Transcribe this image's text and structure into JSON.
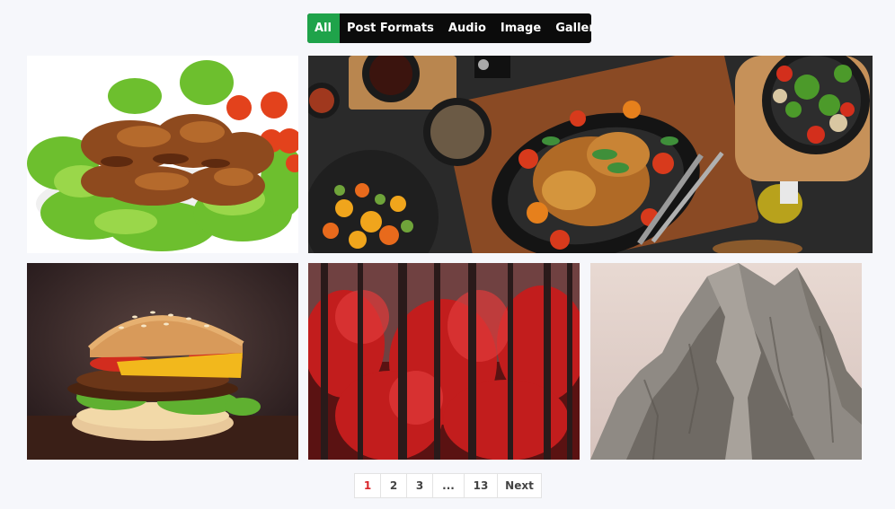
{
  "filters": {
    "items": [
      {
        "label": "All",
        "active": true
      },
      {
        "label": "Post Formats",
        "active": false
      },
      {
        "label": "Audio",
        "active": false
      },
      {
        "label": "Image",
        "active": false
      },
      {
        "label": "Gallery",
        "active": false
      }
    ]
  },
  "colors": {
    "active_tab": "#1fa34a",
    "filter_bar": "#0b0b0b",
    "current_page": "#d9262b",
    "page_bg": "#f6f7fb"
  },
  "gallery": {
    "images": [
      {
        "icon": "chicken-wings-photo"
      },
      {
        "icon": "roast-chicken-feast-photo"
      },
      {
        "icon": "burger-photo"
      },
      {
        "icon": "red-forest-photo"
      },
      {
        "icon": "rocky-mountain-photo"
      }
    ]
  },
  "pagination": {
    "pages": [
      "1",
      "2",
      "3",
      "...",
      "13"
    ],
    "current": "1",
    "next_label": "Next"
  }
}
